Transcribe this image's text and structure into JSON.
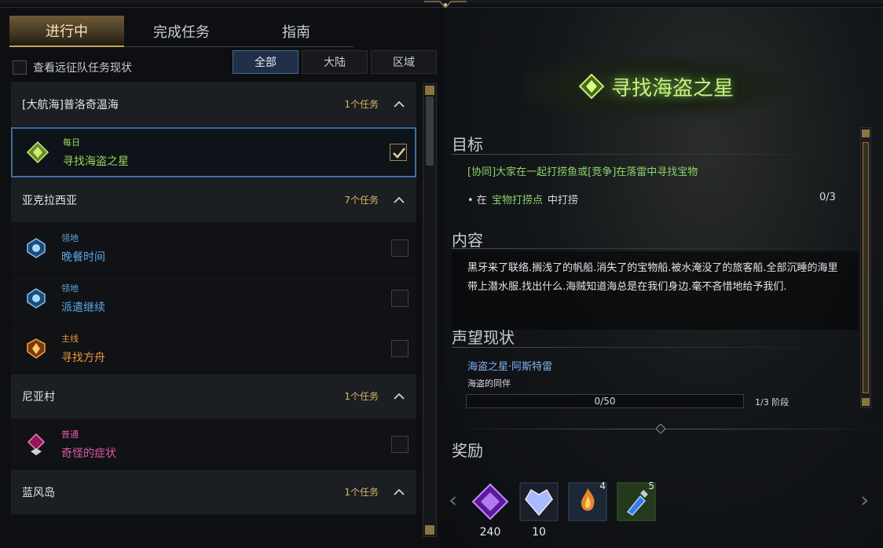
{
  "tabs": [
    {
      "label": "进行中",
      "active": true
    },
    {
      "label": "完成任务",
      "active": false
    },
    {
      "label": "指南",
      "active": false
    }
  ],
  "expedition_checkbox": {
    "label": "查看远征队任务现状",
    "checked": false
  },
  "filters": [
    {
      "label": "全部",
      "active": true
    },
    {
      "label": "大陆",
      "active": false
    },
    {
      "label": "区域",
      "active": false
    }
  ],
  "groups": [
    {
      "title": "[大航海]普洛奇温海",
      "count": "1个任务",
      "quests": [
        {
          "type": "每日",
          "name": "寻找海盗之星",
          "color": "#9ad45a",
          "icon": "daily-quest-icon",
          "checked": true,
          "selected": true
        }
      ]
    },
    {
      "title": "亚克拉西亚",
      "count": "7个任务",
      "quests": [
        {
          "type": "领地",
          "name": "晚餐时间",
          "color": "#5ea6e8",
          "icon": "territory-quest-icon",
          "checked": false,
          "selected": false
        },
        {
          "type": "领地",
          "name": "派遣继续",
          "color": "#5ea6e8",
          "icon": "territory-quest-icon",
          "checked": false,
          "selected": false
        },
        {
          "type": "主线",
          "name": "寻找方舟",
          "color": "#e99a3c",
          "icon": "main-quest-icon",
          "checked": false,
          "selected": false
        }
      ]
    },
    {
      "title": "尼亚村",
      "count": "1个任务",
      "quests": [
        {
          "type": "普通",
          "name": "奇怪的症状",
          "color": "#e25aa8",
          "icon": "normal-quest-icon",
          "checked": false,
          "selected": false
        }
      ]
    },
    {
      "title": "蓝风岛",
      "count": "1个任务",
      "quests": []
    }
  ],
  "detail": {
    "title": "寻找海盗之星",
    "objective_heading": "目标",
    "objective": "[协同]大家在一起打捞鱼或[竞争]在落雷中寻找宝物",
    "sub_objective_prefix": "• 在",
    "sub_objective_highlight": "宝物打捞点",
    "sub_objective_suffix": "中打捞",
    "sub_objective_progress": "0/3",
    "content_heading": "内容",
    "content": "黑牙来了联络.搁浅了的帆船.消失了的宝物船.被水淹没了的旅客船.全部沉睡的海里带上潜水服.找出什么.海贼知道海总是在我们身边.毫不吝惜地给予我们.",
    "reputation_heading": "声望现状",
    "reputation_name": "海盗之星·阿斯特雷",
    "reputation_sub": "海盗的同伴",
    "reputation_progress": "0/50",
    "reputation_stage": "1/3 阶段",
    "rewards_heading": "奖励"
  },
  "rewards": [
    {
      "icon": "purple-crystal-icon",
      "value": "240",
      "count": ""
    },
    {
      "icon": "blue-gem-icon",
      "value": "10",
      "count": ""
    },
    {
      "icon": "flame-chest-icon",
      "value": "",
      "count": "4"
    },
    {
      "icon": "blue-potion-icon",
      "value": "",
      "count": "5"
    }
  ]
}
